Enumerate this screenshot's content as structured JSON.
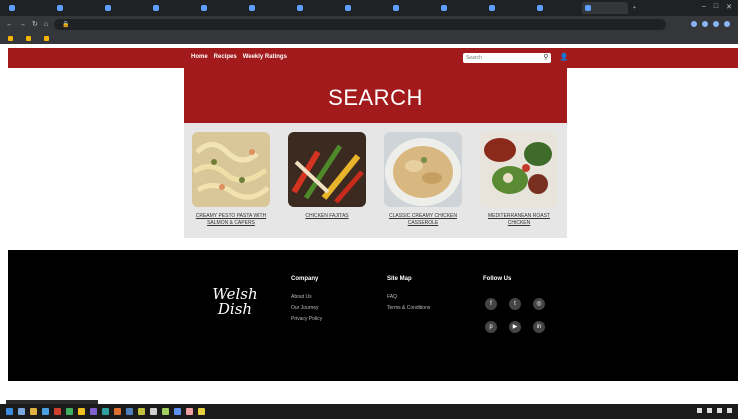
{
  "browser": {
    "tabs": [
      "",
      "",
      "",
      "",
      "",
      "",
      "",
      "",
      "",
      "",
      "",
      "",
      ""
    ],
    "active_tab": 12,
    "url": "",
    "bookmarks": [
      "",
      "",
      ""
    ]
  },
  "nav": {
    "links": [
      "Home",
      "Recipes",
      "Weekly Ratings"
    ],
    "search_placeholder": "Search"
  },
  "hero": {
    "title": "SEARCH"
  },
  "recipes": [
    {
      "label": "CREAMY PESTO PASTA WITH SALMON & CAPERS"
    },
    {
      "label": "CHICKEN FAJITAS"
    },
    {
      "label": "CLASSIC CREAMY CHICKEN CASSEROLE"
    },
    {
      "label": "MEDITERRANEAN ROAST CHICKEN"
    }
  ],
  "footer": {
    "logo_line1": "Welsh",
    "logo_line2": "Dish",
    "company": {
      "heading": "Company",
      "links": [
        "About Us",
        "Our Journey",
        "Privacy Policy"
      ]
    },
    "site_map": {
      "heading": "Site Map",
      "links": [
        "FAQ",
        "Terms & Conditions"
      ]
    },
    "follow": {
      "heading": "Follow Us",
      "icons": [
        "facebook-icon",
        "twitter-icon",
        "instagram-icon",
        "pinterest-icon",
        "youtube-icon",
        "linkedin-icon"
      ]
    }
  },
  "colors": {
    "brand_red": "#a31a1c",
    "footer_bg": "#000000",
    "panel_bg": "#e6e6e6"
  }
}
